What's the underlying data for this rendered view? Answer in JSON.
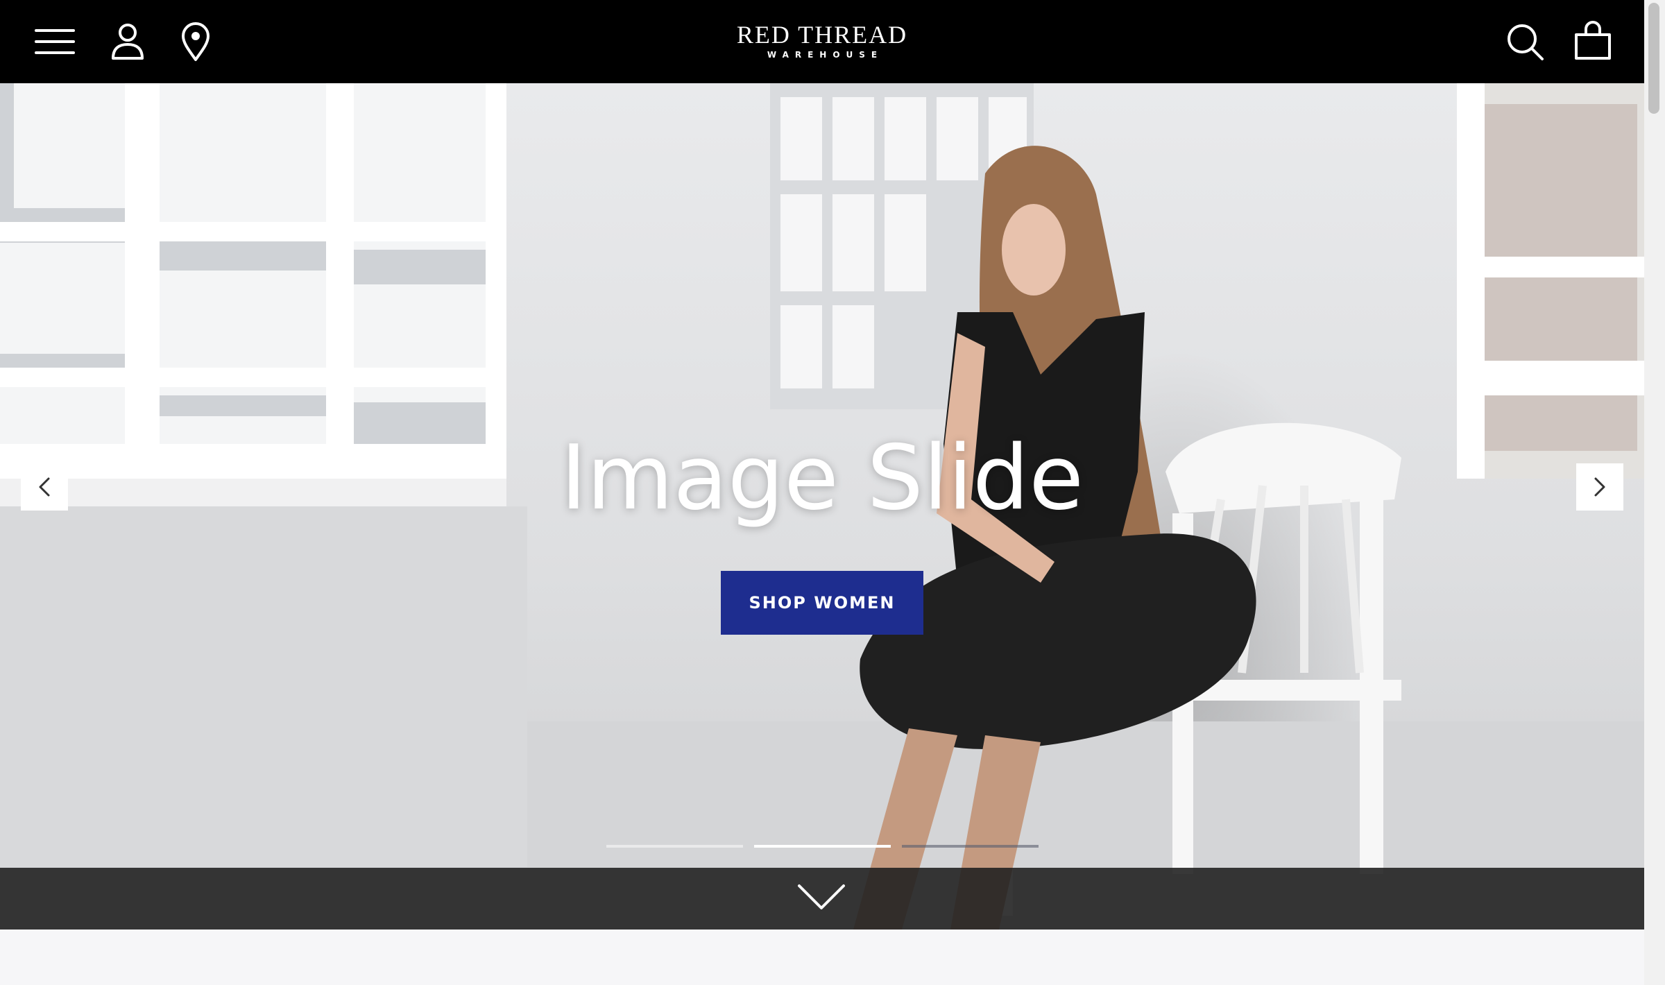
{
  "header": {
    "logo_main": "RED THREAD",
    "logo_sub": "WAREHOUSE",
    "icons": [
      "menu-icon",
      "account-icon",
      "location-pin-icon",
      "search-icon",
      "shopping-bag-icon"
    ]
  },
  "hero": {
    "slide_title": "Image Slide",
    "cta_label": "SHOP WOMEN",
    "slide_count": 3,
    "active_slide_index": 1
  },
  "colors": {
    "header_bg": "#000000",
    "cta_bg": "#1e2d8f",
    "scroll_bar_bg": "#1e1e1e",
    "page_bg": "#f6f6f8"
  }
}
